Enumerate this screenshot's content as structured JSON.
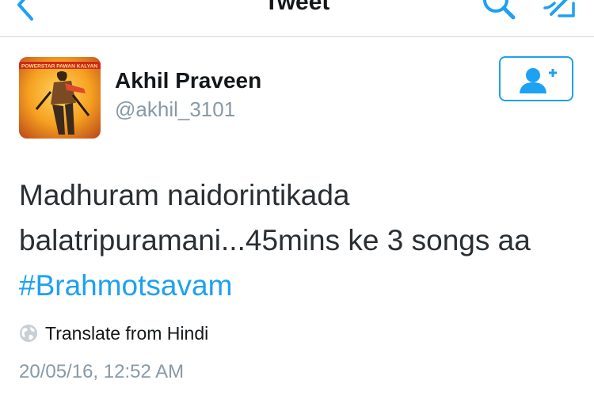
{
  "nav": {
    "title": "Tweet",
    "back_icon": "chevron-left-icon",
    "search_icon": "search-icon",
    "compose_icon": "compose-tweet-icon"
  },
  "author": {
    "display_name": "Akhil Praveen",
    "handle": "@akhil_3101",
    "avatar_banner_text": "POWERSTAR PAWAN KALYAN",
    "follow_icon": "add-user-icon"
  },
  "tweet": {
    "text_line_1": "Madhuram naidorintikada",
    "text_line_2": "balatripuramani...45mins ke 3 songs aa",
    "hashtag": "#Brahmotsavam",
    "translate_label": "Translate from Hindi",
    "translate_icon": "globe-icon",
    "timestamp": "20/05/16, 12:52 AM"
  },
  "colors": {
    "accent": "#1da1f2",
    "text": "#14171a",
    "muted": "#8899a6",
    "divider": "#d4d9dd"
  }
}
